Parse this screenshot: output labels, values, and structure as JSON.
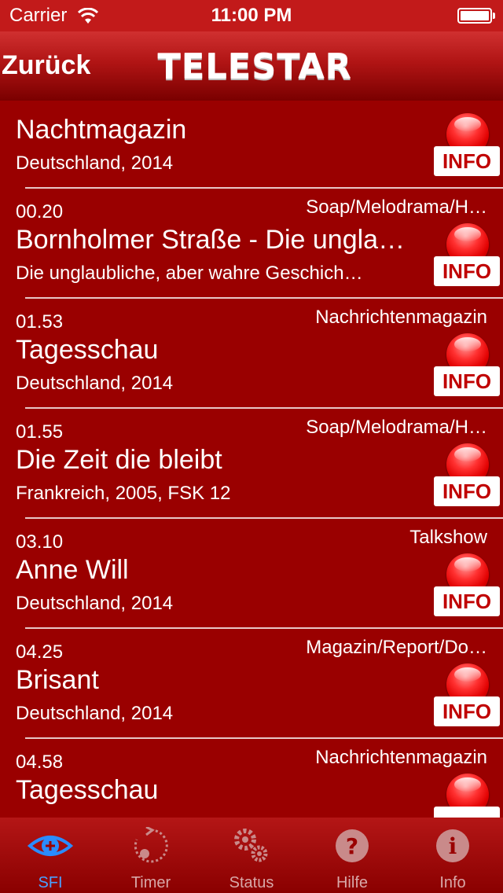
{
  "status_bar": {
    "carrier": "Carrier",
    "time": "11:00 PM"
  },
  "nav": {
    "back_label": "Zurück",
    "logo_text": "TELESTAR"
  },
  "partial_row": {
    "title": "Nachtmagazin",
    "subtitle": "Deutschland, 2014",
    "info_label": "INFO"
  },
  "programs": [
    {
      "time": "00.20",
      "genre": "Soap/Melodrama/H…",
      "title": "Bornholmer Straße - Die ungla…",
      "subtitle": "Die unglaubliche, aber wahre Geschich…",
      "info_label": "INFO"
    },
    {
      "time": "01.53",
      "genre": "Nachrichtenmagazin",
      "title": "Tagesschau",
      "subtitle": "Deutschland, 2014",
      "info_label": "INFO"
    },
    {
      "time": "01.55",
      "genre": "Soap/Melodrama/H…",
      "title": "Die Zeit die bleibt",
      "subtitle": "Frankreich, 2005, FSK 12",
      "info_label": "INFO"
    },
    {
      "time": "03.10",
      "genre": "Talkshow",
      "title": "Anne Will",
      "subtitle": "Deutschland, 2014",
      "info_label": "INFO"
    },
    {
      "time": "04.25",
      "genre": "Magazin/Report/Do…",
      "title": "Brisant",
      "subtitle": "Deutschland, 2014",
      "info_label": "INFO"
    },
    {
      "time": "04.58",
      "genre": "Nachrichtenmagazin",
      "title": "Tagesschau",
      "subtitle": "",
      "info_label": ""
    }
  ],
  "tabs": [
    {
      "label": "SFI",
      "icon": "eye-icon",
      "active": true
    },
    {
      "label": "Timer",
      "icon": "timer-icon",
      "active": false
    },
    {
      "label": "Status",
      "icon": "gears-icon",
      "active": false
    },
    {
      "label": "Hilfe",
      "icon": "help-icon",
      "active": false
    },
    {
      "label": "Info",
      "icon": "info-icon",
      "active": false
    }
  ],
  "colors": {
    "background": "#9a0000",
    "accent": "#4aa0ff",
    "info_text": "#c00000"
  }
}
